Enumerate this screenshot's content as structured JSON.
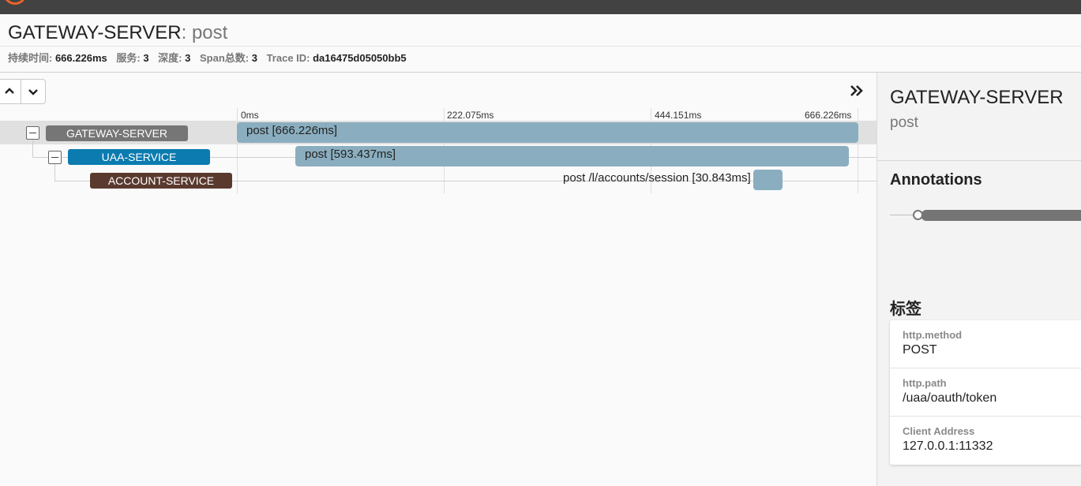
{
  "header": {
    "service_name": "GATEWAY-SERVER",
    "separator": ": ",
    "span_name": "post",
    "meta": [
      {
        "label": "持续时间: ",
        "value": "666.226ms"
      },
      {
        "label": "服务: ",
        "value": "3"
      },
      {
        "label": "深度: ",
        "value": "3"
      },
      {
        "label": "Span总数: ",
        "value": "3"
      },
      {
        "label": "Trace ID: ",
        "value": "da16475d05050bb5"
      }
    ]
  },
  "toolbar": {
    "up_icon": "chevron-up-icon",
    "down_icon": "chevron-down-icon",
    "expand_icon": "double-chevron-right-icon"
  },
  "timeline": {
    "ticks": [
      "0ms",
      "222.075ms",
      "444.151ms",
      "666.226ms"
    ],
    "spans": [
      {
        "service": "GATEWAY-SERVER",
        "label": "post [666.226ms]",
        "service_color": "#767676",
        "selected": true
      },
      {
        "service": "UAA-SERVICE",
        "label": "post [593.437ms]",
        "service_color": "#0b7bb0",
        "selected": false
      },
      {
        "service": "ACCOUNT-SERVICE",
        "label": "post /l/accounts/session [30.843ms]",
        "service_color": "#5a3a2e",
        "selected": false
      }
    ]
  },
  "detail": {
    "service_name": "GATEWAY-SERVER",
    "span_name": "post",
    "annotations_title": "Annotations",
    "tags_title": "标签",
    "tags": [
      {
        "key": "http.method",
        "value": "POST"
      },
      {
        "key": "http.path",
        "value": "/uaa/oauth/token"
      },
      {
        "key": "Client Address",
        "value": "127.0.0.1:11332"
      }
    ]
  }
}
